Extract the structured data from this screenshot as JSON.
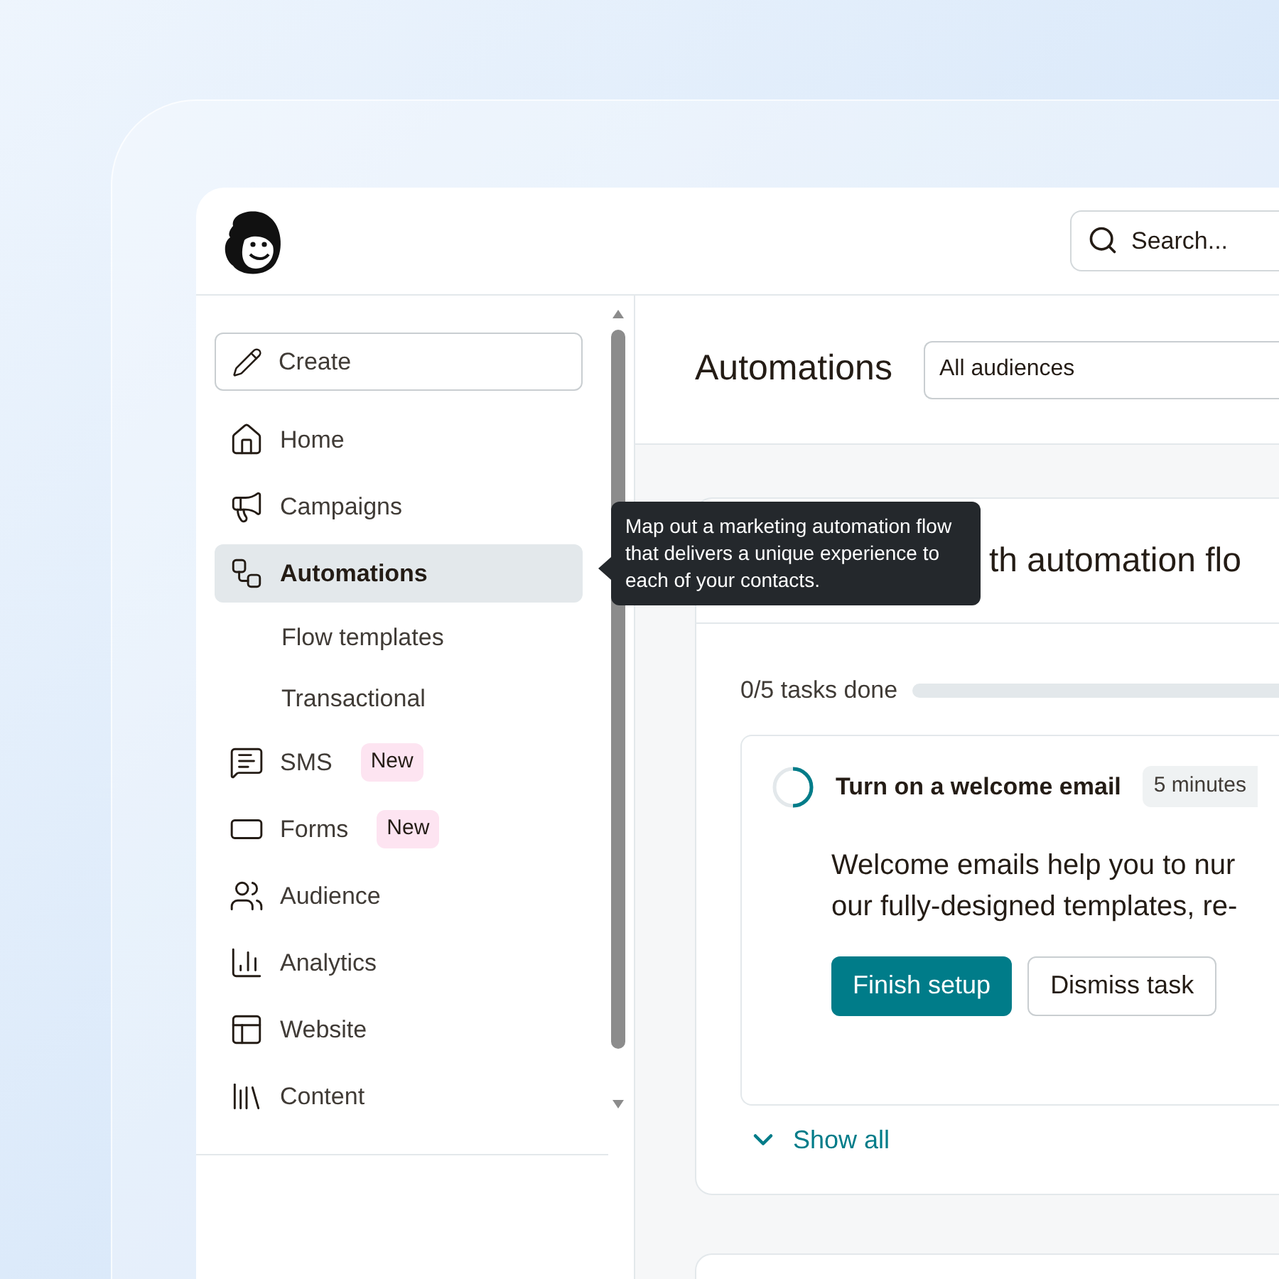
{
  "header": {
    "search": {
      "placeholder": "Search..."
    }
  },
  "sidebar": {
    "create_button": "Create",
    "items": [
      {
        "kind": "main",
        "label": "Home",
        "selected": false
      },
      {
        "kind": "main",
        "label": "Campaigns",
        "selected": false
      },
      {
        "kind": "main",
        "label": "Automations",
        "selected": true
      },
      {
        "kind": "sub",
        "label": "Flow templates",
        "selected": false
      },
      {
        "kind": "sub",
        "label": "Transactional",
        "selected": false
      },
      {
        "kind": "main",
        "label": "SMS",
        "badge": "New",
        "selected": false
      },
      {
        "kind": "main",
        "label": "Forms",
        "badge": "New",
        "selected": false
      },
      {
        "kind": "main",
        "label": "Audience",
        "selected": false
      },
      {
        "kind": "main",
        "label": "Analytics",
        "selected": false
      },
      {
        "kind": "main",
        "label": "Website",
        "selected": false
      },
      {
        "kind": "main",
        "label": "Content",
        "selected": false
      }
    ]
  },
  "tooltip": {
    "text": "Map out a marketing automation flow that delivers a unique experience to each of your contacts."
  },
  "main": {
    "title": "Automations",
    "audience_select": {
      "value": "All audiences"
    },
    "card": {
      "heading": "th automation flo",
      "progress": {
        "label": "0/5 tasks done"
      },
      "task": {
        "title": "Turn on a welcome email",
        "duration": "5 minutes",
        "description": [
          "Welcome emails help you to nur",
          "our fully-designed templates, re-"
        ],
        "buttons": [
          {
            "kind": "primary",
            "label": "Finish setup"
          },
          {
            "kind": "secondary",
            "label": "Dismiss task"
          }
        ]
      },
      "show_all": "Show all"
    }
  }
}
